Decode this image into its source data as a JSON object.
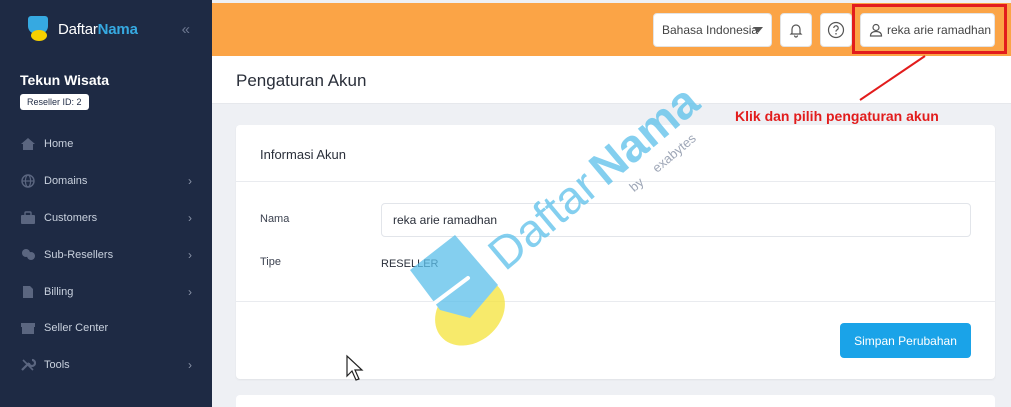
{
  "brand": {
    "part1": "Daftar",
    "part2": "Nama"
  },
  "sidebar": {
    "collapse_glyph": "«",
    "account_name": "Tekun Wisata",
    "reseller_badge": "Reseller ID: 2",
    "items": [
      {
        "label": "Home",
        "icon": "home-icon",
        "has_submenu": false
      },
      {
        "label": "Domains",
        "icon": "globe-icon",
        "has_submenu": true
      },
      {
        "label": "Customers",
        "icon": "briefcase-icon",
        "has_submenu": true
      },
      {
        "label": "Sub-Resellers",
        "icon": "users-icon",
        "has_submenu": true
      },
      {
        "label": "Billing",
        "icon": "document-icon",
        "has_submenu": true
      },
      {
        "label": "Seller Center",
        "icon": "store-icon",
        "has_submenu": false
      },
      {
        "label": "Tools",
        "icon": "wrench-icon",
        "has_submenu": true
      }
    ]
  },
  "header": {
    "language": "Bahasa Indonesia",
    "user_name": "reka arie ramadhan"
  },
  "page": {
    "title": "Pengaturan Akun"
  },
  "account_card": {
    "title": "Informasi Akun",
    "name_label": "Nama",
    "name_value": "reka arie ramadhan",
    "type_label": "Tipe",
    "type_value": "RESELLER",
    "save_label": "Simpan Perubahan"
  },
  "annotation": {
    "text": "Klik dan pilih pengaturan akun",
    "color": "#e21c1c"
  },
  "watermark": {
    "part1": "Daftar",
    "part2": "Nama",
    "by": "by",
    "sub": "exabytes"
  },
  "colors": {
    "sidebar_bg": "#1e2a44",
    "topbar_bg": "#fba446",
    "primary_button": "#1aa3e8",
    "brand_blue": "#36a9e1",
    "brand_yellow": "#f5d000"
  }
}
